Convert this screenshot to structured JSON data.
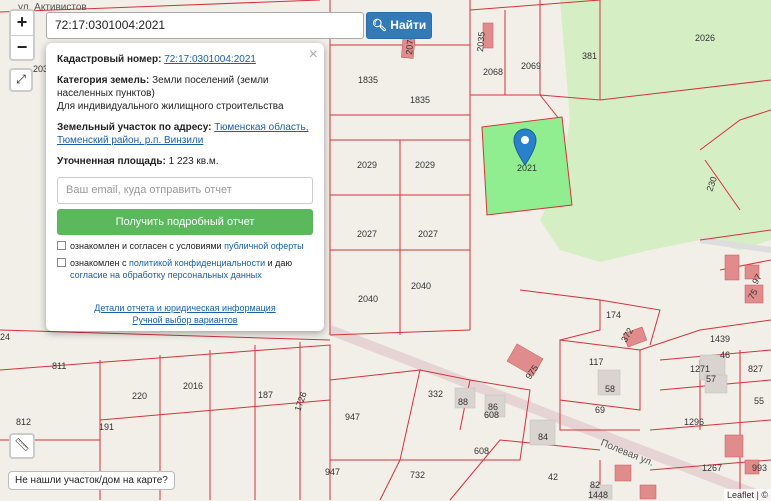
{
  "search": {
    "value": "72:17:0301004:2021",
    "button": "Найти",
    "button_icon": "search-icon"
  },
  "zoom": {
    "in": "+",
    "out": "−"
  },
  "map": {
    "street_labels": [
      "ул. Активистов",
      "Полевая ул."
    ],
    "parcel_labels": [
      "2035",
      "2076",
      "2068",
      "2069",
      "381",
      "2026",
      "1835",
      "1835",
      "2029",
      "2029",
      "2027",
      "2027",
      "2040",
      "2040",
      "2021",
      "174",
      "372",
      "117",
      "58",
      "69",
      "1439",
      "46",
      "1271",
      "57",
      "827",
      "1296",
      "811",
      "220",
      "2016",
      "187",
      "1726",
      "332",
      "88",
      "86",
      "608",
      "947",
      "84",
      "608",
      "812",
      "191",
      "947",
      "732",
      "42",
      "82",
      "1448",
      "1267",
      "993",
      "55",
      "230",
      "203",
      "24",
      "975",
      "97",
      "75"
    ],
    "selected_parcel": "2021",
    "colors": {
      "parcel_border": "#d3333c",
      "selected_fill": "#90ee90",
      "green_area": "#d6eec4",
      "marker": "#2a81cb"
    }
  },
  "popup": {
    "cadastral_label": "Кадастровый номер:",
    "cadastral_value": "72:17:0301004:2021",
    "category_label": "Категория земель:",
    "category_value": "Земли поселений (земли населенных пунктов)",
    "category_use": "Для индивидуального жилищного строительства",
    "address_label": "Земельный участок по адресу:",
    "address_value": "Тюменская область, Тюменский район, р.п. Винзили",
    "area_label": "Уточненная площадь:",
    "area_value": "1 223 кв.м.",
    "email_placeholder": "Ваш email, куда отправить отчет",
    "report_button": "Получить подробный отчет",
    "consent1_text": "ознакомлен и согласен с условиями",
    "consent1_link": "публичной оферты",
    "consent2_text": "ознакомлен с",
    "consent2_link1": "политикой конфиденциальности",
    "consent2_mid": "и даю",
    "consent2_link2": "согласие на обработку персональных данных",
    "details_link": "Детали отчета и юридическая информация",
    "manual_link": "Ручной выбор вариантов",
    "close": "×"
  },
  "not_found": "Не нашли участок/дом на карте?",
  "attribution": "Leaflet | ©"
}
